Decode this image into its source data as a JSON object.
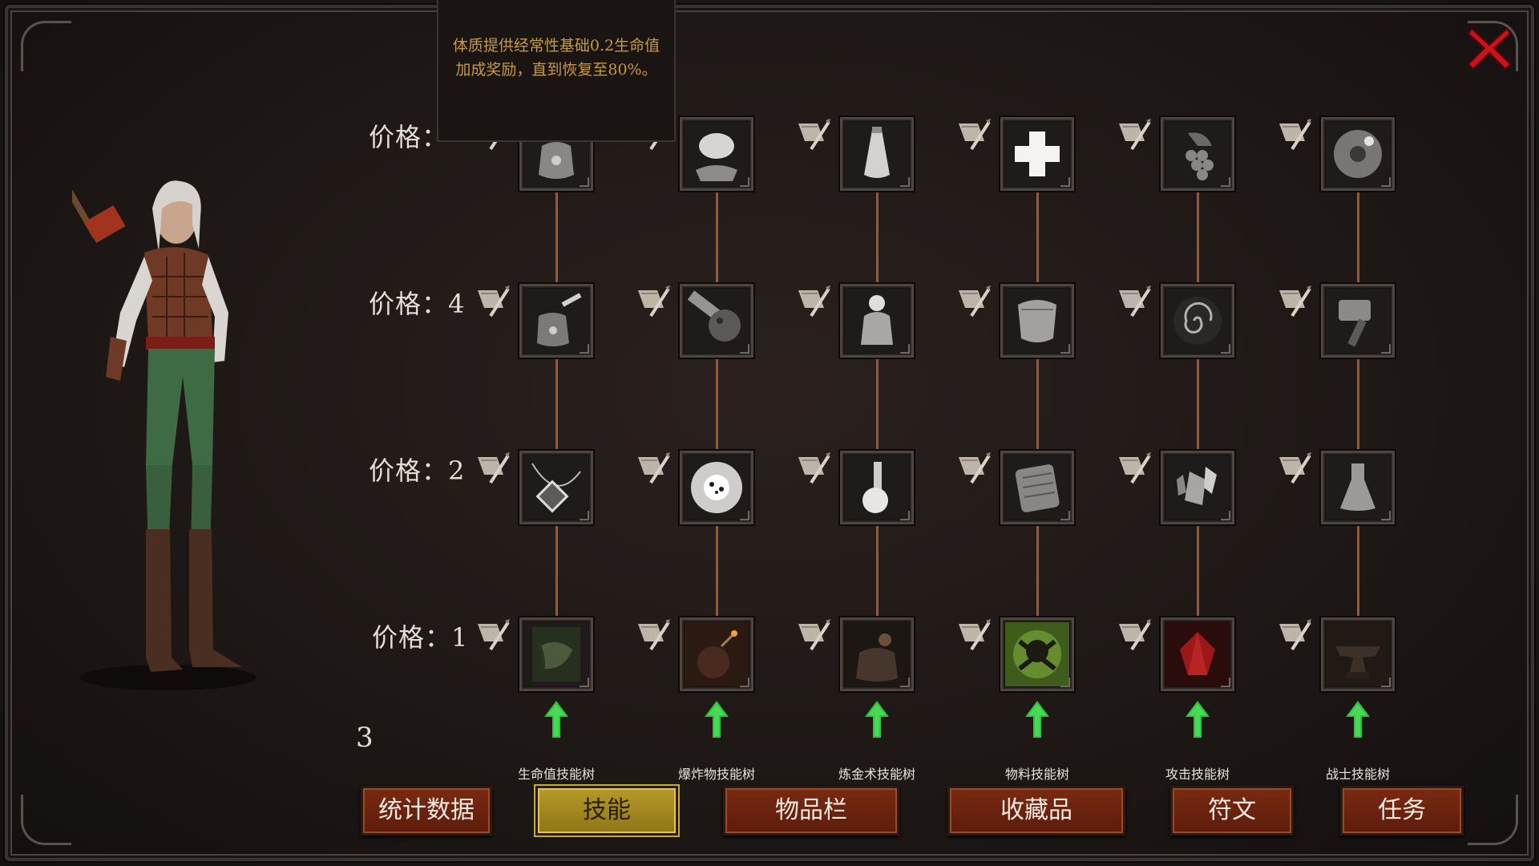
{
  "tooltip": {
    "text": "体质提供经常性基础0.2生命值加成奖励，直到恢复至80%。"
  },
  "price_labels": [
    "价格：",
    "价格：4",
    "价格：2",
    "价格：1"
  ],
  "skill_points": "3",
  "skill_trees": [
    {
      "label": "生命值技能树",
      "icons": [
        "pouch-icon",
        "pouch-glow-icon",
        "pendant-icon",
        "scroll-roll-icon"
      ]
    },
    {
      "label": "爆炸物技能树",
      "icons": [
        "brain-hand-icon",
        "meteor-icon",
        "burst-icon",
        "bomb-icon"
      ]
    },
    {
      "label": "炼金术技能树",
      "icons": [
        "vial-icon",
        "figure-icon",
        "flask-round-icon",
        "bag-icon"
      ]
    },
    {
      "label": "物料技能树",
      "icons": [
        "cross-icon",
        "parchment-icon",
        "plate-icon",
        "skull-icon"
      ]
    },
    {
      "label": "攻击技能树",
      "icons": [
        "grapes-icon",
        "vortex-icon",
        "crystals-icon",
        "red-gem-icon"
      ]
    },
    {
      "label": "战士技能树",
      "icons": [
        "disc-icon",
        "hammer-icon",
        "flask-conical-icon",
        "anvil-icon"
      ]
    }
  ],
  "tabs": [
    {
      "label": "统计数据",
      "active": false
    },
    {
      "label": "技能",
      "active": true
    },
    {
      "label": "物品栏",
      "active": false
    },
    {
      "label": "收藏品",
      "active": false
    },
    {
      "label": "符文",
      "active": false
    },
    {
      "label": "任务",
      "active": false
    }
  ],
  "colors": {
    "accent": "#b69a28",
    "button": "#7a2a12",
    "connector": "#a4532d",
    "close": "#c8141e",
    "upgrade": "#2ec43a",
    "tooltip_text": "#c79a3f"
  }
}
